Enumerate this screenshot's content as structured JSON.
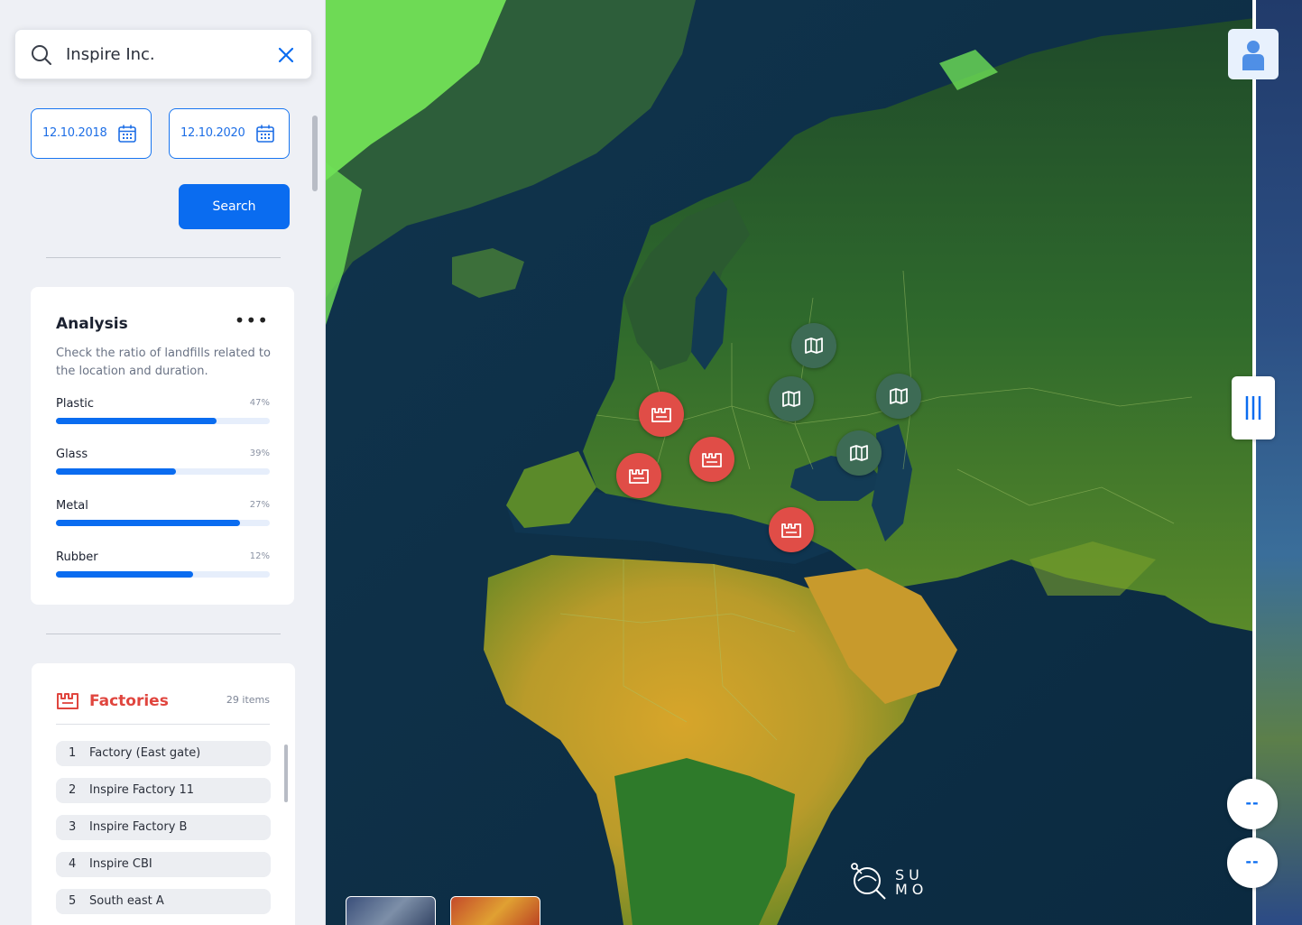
{
  "search": {
    "query": "Inspire Inc."
  },
  "dates": {
    "from": "12.10.2018",
    "to": "12.10.2020"
  },
  "search_button": "Search",
  "analysis": {
    "title": "Analysis",
    "menu": "•••",
    "description": "Check the ratio of landfills related to the location and duration.",
    "metrics": [
      {
        "label": "Plastic",
        "percent": "47%",
        "fill": 0.75
      },
      {
        "label": "Glass",
        "percent": "39%",
        "fill": 0.56
      },
      {
        "label": "Metal",
        "percent": "27%",
        "fill": 0.86
      },
      {
        "label": "Rubber",
        "percent": "12%",
        "fill": 0.64
      }
    ]
  },
  "factories": {
    "title": "Factories",
    "count": "29 items",
    "items": [
      {
        "num": "1",
        "name": "Factory (East gate)"
      },
      {
        "num": "2",
        "name": "Inspire Factory 11"
      },
      {
        "num": "3",
        "name": "Inspire Factory B"
      },
      {
        "num": "4",
        "name": "Inspire CBI"
      },
      {
        "num": "5",
        "name": "South east A"
      }
    ]
  },
  "map": {
    "markers": [
      {
        "type": "landfill",
        "icon": "map-icon"
      },
      {
        "type": "landfill",
        "icon": "map-icon"
      },
      {
        "type": "landfill",
        "icon": "map-icon"
      },
      {
        "type": "landfill",
        "icon": "map-icon"
      },
      {
        "type": "factory",
        "icon": "factory-icon"
      },
      {
        "type": "factory",
        "icon": "factory-icon"
      },
      {
        "type": "factory",
        "icon": "factory-icon"
      },
      {
        "type": "factory",
        "icon": "factory-icon"
      }
    ],
    "logo": {
      "line1": "SU",
      "line2": "MO"
    },
    "zoom_in": "--",
    "zoom_out": "--"
  },
  "colors": {
    "accent": "#0a6cf0",
    "factory": "#e04d47",
    "landfill": "#3d6b55"
  }
}
